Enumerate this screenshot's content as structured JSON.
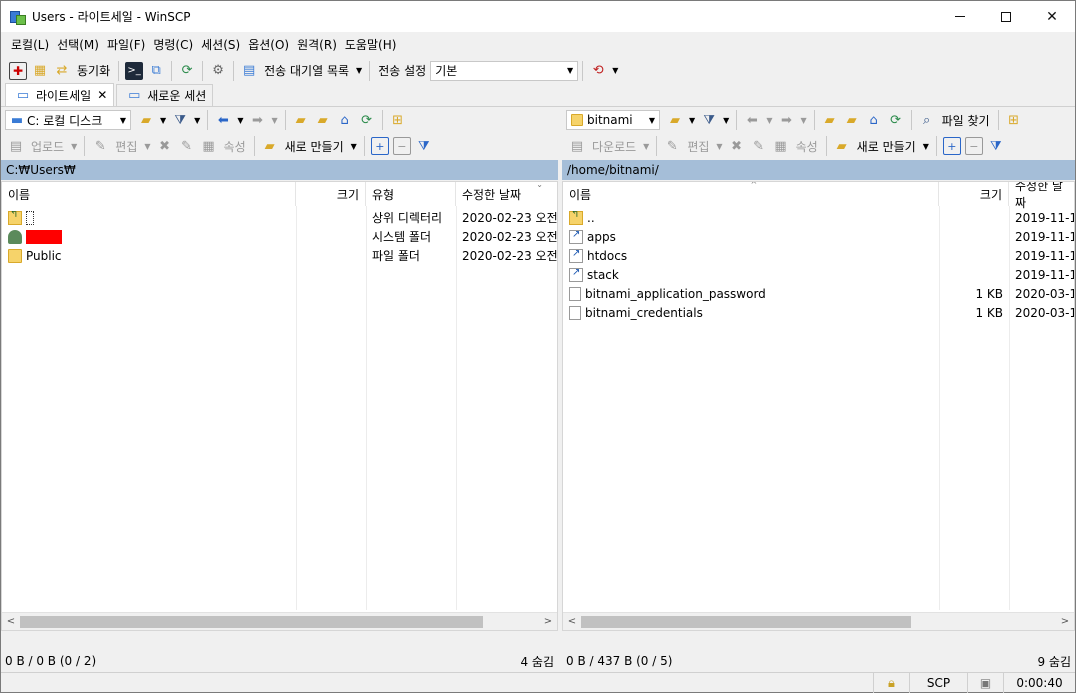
{
  "window": {
    "title": "Users - 라이트세일 - WinSCP",
    "controls": {
      "minimize": "—",
      "maximize": "☐",
      "close": "✕"
    }
  },
  "menu": [
    "로컬(L)",
    "선택(M)",
    "파일(F)",
    "명령(C)",
    "세션(S)",
    "옵션(O)",
    "원격(R)",
    "도움말(H)"
  ],
  "toolbar": {
    "sync_label": "동기화",
    "queue_label": "전송 대기열 목록",
    "transfer_settings_label": "전송 설정",
    "transfer_preset": "기본"
  },
  "tabs": [
    {
      "label": "라이트세일",
      "close": "✕",
      "active": true
    },
    {
      "label": "새로운 세션",
      "active": false
    }
  ],
  "left_panel": {
    "drive": "C: 로컬 디스크",
    "upload_label": "업로드",
    "edit_label": "편집",
    "properties_label": "속성",
    "new_label": "새로 만들기",
    "path": "C:₩Users₩",
    "columns": [
      "이름",
      "크기",
      "유형",
      "수정한 날짜"
    ],
    "rows": [
      {
        "icon": "parent-folder",
        "name": "",
        "size": "",
        "type": "상위 디렉터리",
        "date": "2020-02-23  오전"
      },
      {
        "icon": "user-folder",
        "name": "",
        "size": "",
        "type": "시스템 폴더",
        "date": "2020-02-23  오전"
      },
      {
        "icon": "folder",
        "name": "Public",
        "size": "",
        "type": "파일 폴더",
        "date": "2020-02-23  오전"
      }
    ],
    "status_left": "0 B / 0 B (0 / 2)",
    "status_right": "4 숨김"
  },
  "right_panel": {
    "location": "bitnami",
    "download_label": "다운로드",
    "edit_label": "편집",
    "properties_label": "속성",
    "new_label": "새로 만들기",
    "find_files_label": "파일 찾기",
    "path": "/home/bitnami/",
    "columns": [
      "이름",
      "크기",
      "수정한 날짜"
    ],
    "rows": [
      {
        "icon": "parent-folder",
        "name": "..",
        "size": "",
        "date": "2019-11-1"
      },
      {
        "icon": "link-folder",
        "name": "apps",
        "size": "",
        "date": "2019-11-1"
      },
      {
        "icon": "link-folder",
        "name": "htdocs",
        "size": "",
        "date": "2019-11-1"
      },
      {
        "icon": "link-folder",
        "name": "stack",
        "size": "",
        "date": "2019-11-1"
      },
      {
        "icon": "file",
        "name": "bitnami_application_password",
        "size": "1 KB",
        "date": "2020-03-1"
      },
      {
        "icon": "file",
        "name": "bitnami_credentials",
        "size": "1 KB",
        "date": "2020-03-1"
      }
    ],
    "status_left": "0 B / 437 B (0 / 5)",
    "status_right": "9 숨김"
  },
  "statusbar": {
    "protocol": "SCP",
    "time": "0:00:40"
  }
}
